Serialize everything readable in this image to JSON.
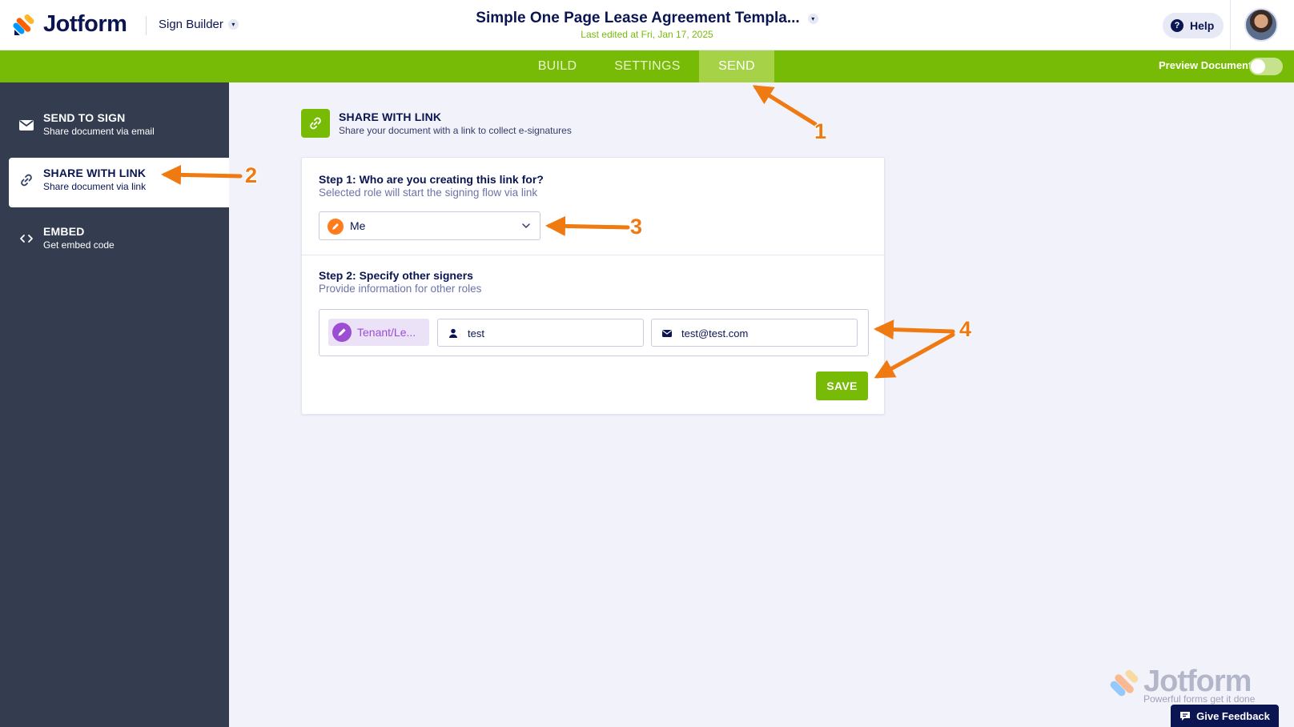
{
  "app": {
    "brand": "Jotform",
    "builder_switch": "Sign Builder"
  },
  "document": {
    "title": "Simple One Page Lease Agreement Templa...",
    "last_edited": "Last edited at Fri, Jan 17, 2025"
  },
  "header": {
    "help_label": "Help"
  },
  "nav": {
    "tabs": [
      {
        "label": "BUILD"
      },
      {
        "label": "SETTINGS"
      },
      {
        "label": "SEND",
        "active": true
      }
    ],
    "preview_label": "Preview Document",
    "preview_enabled": false
  },
  "sidebar": {
    "items": [
      {
        "title": "SEND TO SIGN",
        "desc": "Share document via email",
        "icon": "envelope-icon"
      },
      {
        "title": "SHARE WITH LINK",
        "desc": "Share document via link",
        "icon": "link-icon",
        "active": true
      },
      {
        "title": "EMBED",
        "desc": "Get embed code",
        "icon": "code-icon"
      }
    ]
  },
  "main": {
    "section_title": "SHARE WITH LINK",
    "section_desc": "Share your document with a link to collect e-signatures",
    "step1": {
      "title": "Step 1: Who are you creating this link for?",
      "desc": "Selected role will start the signing flow via link",
      "selected_role": "Me"
    },
    "step2": {
      "title": "Step 2: Specify other signers",
      "desc": "Provide information for other roles",
      "signer": {
        "role": "Tenant/Le...",
        "name": "test",
        "email": "test@test.com"
      }
    },
    "save_label": "SAVE"
  },
  "watermark": {
    "brand": "Jotform",
    "tagline": "Powerful forms get it done"
  },
  "feedback_label": "Give Feedback",
  "annotations": [
    "1",
    "2",
    "3",
    "4"
  ],
  "colors": {
    "brand_green": "#78bb07",
    "navy": "#0a1551",
    "sidebar_bg": "#343c50",
    "annotation_orange": "#f07a12",
    "role_orange": "#ff7b1c",
    "role_purple": "#9c4dd3"
  }
}
